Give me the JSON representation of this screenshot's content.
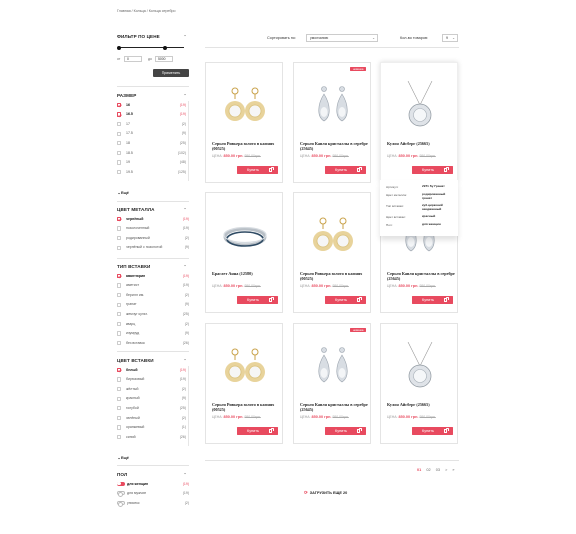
{
  "breadcrumb": "Главная / Кольца / Кольца серебро",
  "colors": {
    "accent": "#e84a5f",
    "dark": "#444444"
  },
  "price_filter": {
    "title": "ФИЛЬТР ПО ЦЕНЕ",
    "from_label": "от",
    "from_value": "0",
    "to_label": "до",
    "to_value": "5000",
    "apply_label": "Применить"
  },
  "size_filter": {
    "title": "РАЗМЕР",
    "items": [
      {
        "label": "16",
        "count": "(19)",
        "checked": true
      },
      {
        "label": "16.5",
        "count": "(19)",
        "checked": true
      },
      {
        "label": "17",
        "count": "(2)",
        "checked": false
      },
      {
        "label": "17.5",
        "count": "(9)",
        "checked": false
      },
      {
        "label": "18",
        "count": "(25)",
        "checked": false
      },
      {
        "label": "18.5",
        "count": "(102)",
        "checked": false
      },
      {
        "label": "19",
        "count": "(48)",
        "checked": false
      },
      {
        "label": "19.5",
        "count": "(125)",
        "checked": false
      }
    ],
    "more_label": "Ещё"
  },
  "metal_filter": {
    "title": "ЦВЕТ МЕТАЛЛА",
    "items": [
      {
        "label": "чернёный",
        "count": "(19)",
        "checked": true
      },
      {
        "label": "позолоченный",
        "count": "(19)",
        "checked": false
      },
      {
        "label": "родированный",
        "count": "(2)",
        "checked": false
      },
      {
        "label": "чернёный с позолотой",
        "count": "(9)",
        "checked": false
      }
    ]
  },
  "insert_filter": {
    "title": "ТИП ВСТАВКИ",
    "items": [
      {
        "label": "авантюрин",
        "count": "(19)",
        "checked": true
      },
      {
        "label": "аметист",
        "count": "(19)",
        "checked": false
      },
      {
        "label": "берилл им.",
        "count": "(2)",
        "checked": false
      },
      {
        "label": "гранат",
        "count": "(9)",
        "checked": false
      },
      {
        "label": "жемчуг культ.",
        "count": "(25)",
        "checked": false
      },
      {
        "label": "кварц",
        "count": "(2)",
        "checked": false
      },
      {
        "label": "изумруд",
        "count": "(9)",
        "checked": false
      },
      {
        "label": "без вставок",
        "count": "(26)",
        "checked": false
      }
    ]
  },
  "insert_color_filter": {
    "title": "ЦВЕТ ВСТАВКИ",
    "items": [
      {
        "label": "белый",
        "count": "(19)",
        "checked": true
      },
      {
        "label": "бирюзовый",
        "count": "(19)",
        "checked": false
      },
      {
        "label": "жёлтый",
        "count": "(2)",
        "checked": false
      },
      {
        "label": "красный",
        "count": "(9)",
        "checked": false
      },
      {
        "label": "голубой",
        "count": "(25)",
        "checked": false
      },
      {
        "label": "зелёный",
        "count": "(2)",
        "checked": false
      },
      {
        "label": "оранжевый",
        "count": "(1)",
        "checked": false
      },
      {
        "label": "синий",
        "count": "(26)",
        "checked": false
      }
    ],
    "more_label": "Ещё"
  },
  "gender_filter": {
    "title": "ПОЛ",
    "items": [
      {
        "label": "для женщин",
        "count": "(19)",
        "on": true
      },
      {
        "label": "для мужчин",
        "count": "(19)",
        "on": false
      },
      {
        "label": "унисекс",
        "count": "(2)",
        "on": false
      }
    ]
  },
  "sort": {
    "label": "Сортировать по:",
    "value": "умолчанию",
    "count_label": "Кол-во товаров:",
    "count_value": "9"
  },
  "products": [
    {
      "name": "Серьги Ривьера золото в камнях (00525)",
      "price_label": "ЦЕНА:",
      "price": "850.00 грн.",
      "old_price": "950.00грн.",
      "buy_label": "Купить",
      "image": "earrings-gold",
      "badge": ""
    },
    {
      "name": "Серьги Капля кристаллы в серебре (25645)",
      "price_label": "ЦЕНА:",
      "price": "850.00 грн.",
      "old_price": "950.00грн.",
      "buy_label": "Купить",
      "image": "earrings-drop",
      "badge": "новинка"
    },
    {
      "name": "Кулон Айсберг (25665)",
      "price_label": "ЦЕНА:",
      "price": "850.00 грн.",
      "old_price": "950.00грн.",
      "buy_label": "Купить",
      "image": "pendant",
      "badge": ""
    },
    {
      "name": "Браслет Анна (12580)",
      "price_label": "ЦЕНА:",
      "price": "850.00 грн.",
      "old_price": "950.00грн.",
      "buy_label": "Купить",
      "image": "bracelet",
      "badge": ""
    },
    {
      "name": "Серьги Ривьера золото в камнях (00525)",
      "price_label": "ЦЕНА:",
      "price": "850.00 грн.",
      "old_price": "950.00грн.",
      "buy_label": "Купить",
      "image": "earrings-gold",
      "badge": ""
    },
    {
      "name": "Серьги Капля кристаллы в серебре (25645)",
      "price_label": "ЦЕНА:",
      "price": "850.00 грн.",
      "old_price": "950.00грн.",
      "buy_label": "Купить",
      "image": "earrings-drop",
      "badge": ""
    },
    {
      "name": "Серьги Ривьера золото в камнях (00525)",
      "price_label": "ЦЕНА:",
      "price": "850.00 грн.",
      "old_price": "950.00грн.",
      "buy_label": "Купить",
      "image": "earrings-gold",
      "badge": ""
    },
    {
      "name": "Серьги Капля кристаллы в серебре (25645)",
      "price_label": "ЦЕНА:",
      "price": "850.00 грн.",
      "old_price": "950.00грн.",
      "buy_label": "Купить",
      "image": "earrings-drop",
      "badge": "новинка"
    },
    {
      "name": "Кулон Айсберг (25665)",
      "price_label": "ЦЕНА:",
      "price": "850.00 грн.",
      "old_price": "950.00грн.",
      "buy_label": "Купить",
      "image": "pendant",
      "badge": ""
    }
  ],
  "hover_specs": [
    {
      "key": "Артикул:",
      "value": "2971 Sy Гранат"
    },
    {
      "key": "Цвет металла:",
      "value": "родированный гранат"
    },
    {
      "key": "Тип вставки:",
      "value": "куб.цирконий ахеджанный"
    },
    {
      "key": "Цвет вставки:",
      "value": "красный"
    },
    {
      "key": "Пол:",
      "value": "для женщин"
    }
  ],
  "pagination": {
    "pages": [
      "01",
      "02",
      "03"
    ],
    "active": 0,
    "next": ">",
    "last": "»"
  },
  "load_more": "ЗАГРУЗИТЬ ЕЩЕ 20"
}
